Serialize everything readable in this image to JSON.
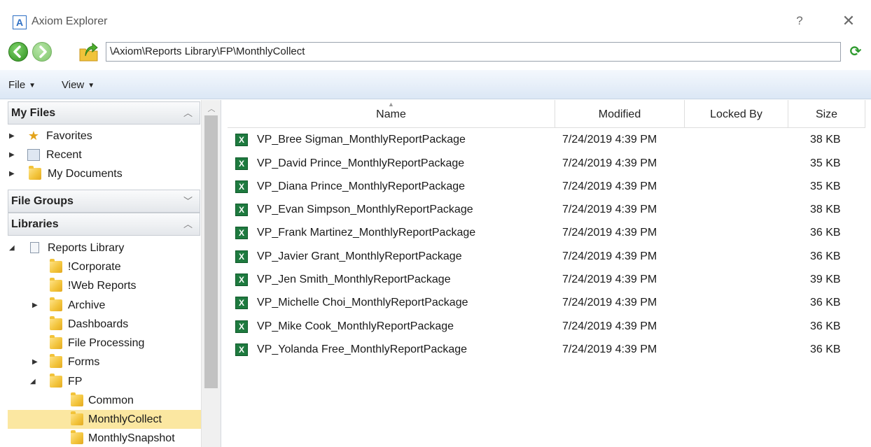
{
  "window": {
    "logo_letter": "A",
    "title": "Axiom Explorer",
    "help": "?",
    "close": "✕"
  },
  "address": {
    "path": "\\Axiom\\Reports Library\\FP\\MonthlyCollect"
  },
  "menu": {
    "file": "File",
    "view": "View"
  },
  "sidebar": {
    "my_files_header": "My Files",
    "my_files_items": [
      {
        "label": "Favorites",
        "icon": "star-icon"
      },
      {
        "label": "Recent",
        "icon": "recent-icon"
      },
      {
        "label": "My Documents",
        "icon": "folder-icon"
      }
    ],
    "file_groups_header": "File Groups",
    "libraries_header": "Libraries",
    "library_tree": [
      {
        "label": "Reports Library",
        "expanded": true
      },
      {
        "label": "!Corporate"
      },
      {
        "label": "!Web Reports"
      },
      {
        "label": "Archive",
        "collapsed": true
      },
      {
        "label": "Dashboards"
      },
      {
        "label": "File Processing"
      },
      {
        "label": "Forms",
        "collapsed": true
      },
      {
        "label": "FP",
        "expanded": true
      },
      {
        "label": "Common"
      },
      {
        "label": "MonthlyCollect",
        "selected": true
      },
      {
        "label": "MonthlySnapshot"
      }
    ]
  },
  "table": {
    "columns": {
      "name": "Name",
      "modified": "Modified",
      "locked_by": "Locked By",
      "size": "Size"
    },
    "rows": [
      {
        "name": "VP_Bree Sigman_MonthlyReportPackage",
        "modified": "7/24/2019 4:39 PM",
        "locked_by": "",
        "size": "38 KB"
      },
      {
        "name": "VP_David Prince_MonthlyReportPackage",
        "modified": "7/24/2019 4:39 PM",
        "locked_by": "",
        "size": "35 KB"
      },
      {
        "name": "VP_Diana Prince_MonthlyReportPackage",
        "modified": "7/24/2019 4:39 PM",
        "locked_by": "",
        "size": "35 KB"
      },
      {
        "name": "VP_Evan Simpson_MonthlyReportPackage",
        "modified": "7/24/2019 4:39 PM",
        "locked_by": "",
        "size": "38 KB"
      },
      {
        "name": "VP_Frank Martinez_MonthlyReportPackage",
        "modified": "7/24/2019 4:39 PM",
        "locked_by": "",
        "size": "36 KB"
      },
      {
        "name": "VP_Javier Grant_MonthlyReportPackage",
        "modified": "7/24/2019 4:39 PM",
        "locked_by": "",
        "size": "36 KB"
      },
      {
        "name": "VP_Jen Smith_MonthlyReportPackage",
        "modified": "7/24/2019 4:39 PM",
        "locked_by": "",
        "size": "39 KB"
      },
      {
        "name": "VP_Michelle Choi_MonthlyReportPackage",
        "modified": "7/24/2019 4:39 PM",
        "locked_by": "",
        "size": "36 KB"
      },
      {
        "name": "VP_Mike Cook_MonthlyReportPackage",
        "modified": "7/24/2019 4:39 PM",
        "locked_by": "",
        "size": "36 KB"
      },
      {
        "name": "VP_Yolanda Free_MonthlyReportPackage",
        "modified": "7/24/2019 4:39 PM",
        "locked_by": "",
        "size": "36 KB"
      }
    ]
  },
  "colors": {
    "selection": "#fbe7a1",
    "menubar": "#dbe7f5",
    "excel_green": "#1e7a3f"
  }
}
